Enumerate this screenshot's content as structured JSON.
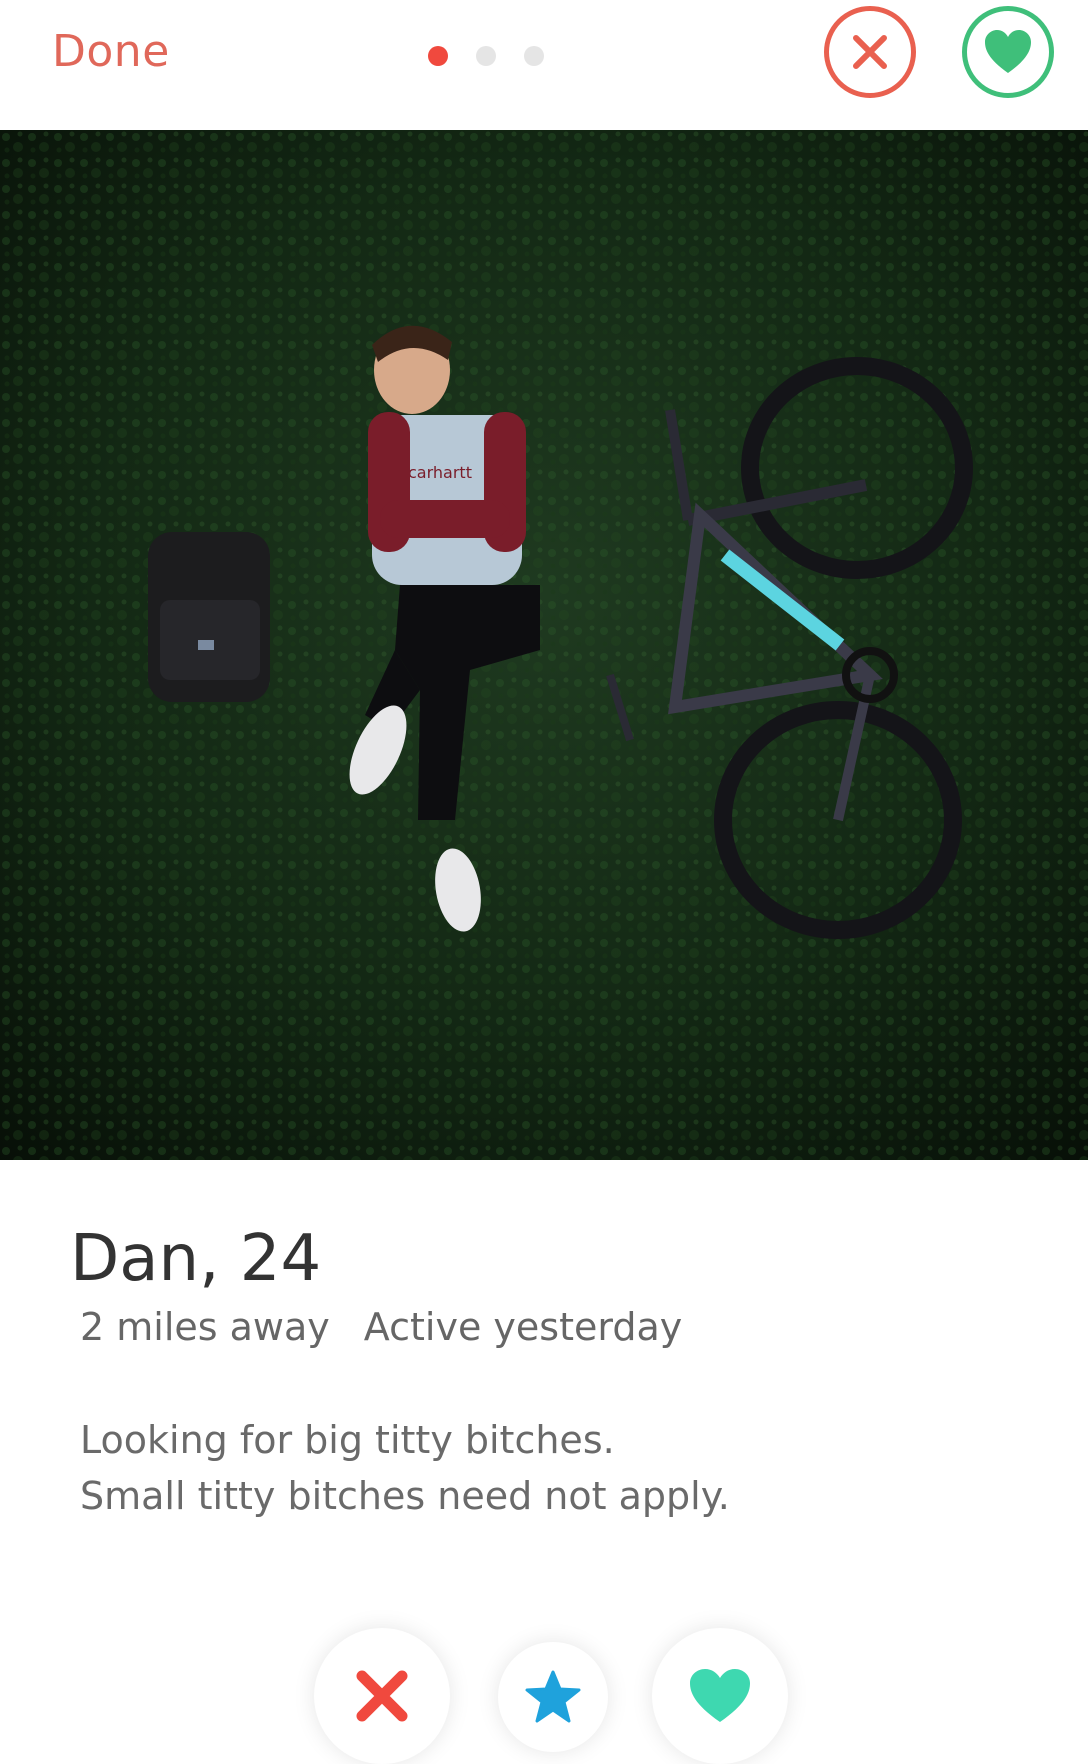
{
  "header": {
    "done_label": "Done",
    "photo_pager": {
      "count": 3,
      "active_index": 0
    },
    "pass_icon": "close-circle-icon",
    "like_icon": "heart-circle-icon"
  },
  "profile": {
    "name_age": "Dan, 24",
    "distance": "2 miles away",
    "activity": "Active yesterday",
    "bio_lines": [
      "Looking for big titty bitches.",
      "Small titty bitches need not apply."
    ],
    "photo_text": "carhartt"
  },
  "actions": {
    "pass_icon": "x-icon",
    "superlike_icon": "star-icon",
    "like_icon": "heart-icon"
  },
  "colors": {
    "accent_red": "#f0493e",
    "pass_red": "#e9604f",
    "like_green": "#3fbf7a",
    "superlike_blue": "#1fa2dc",
    "like_teal": "#3ed8b0"
  }
}
